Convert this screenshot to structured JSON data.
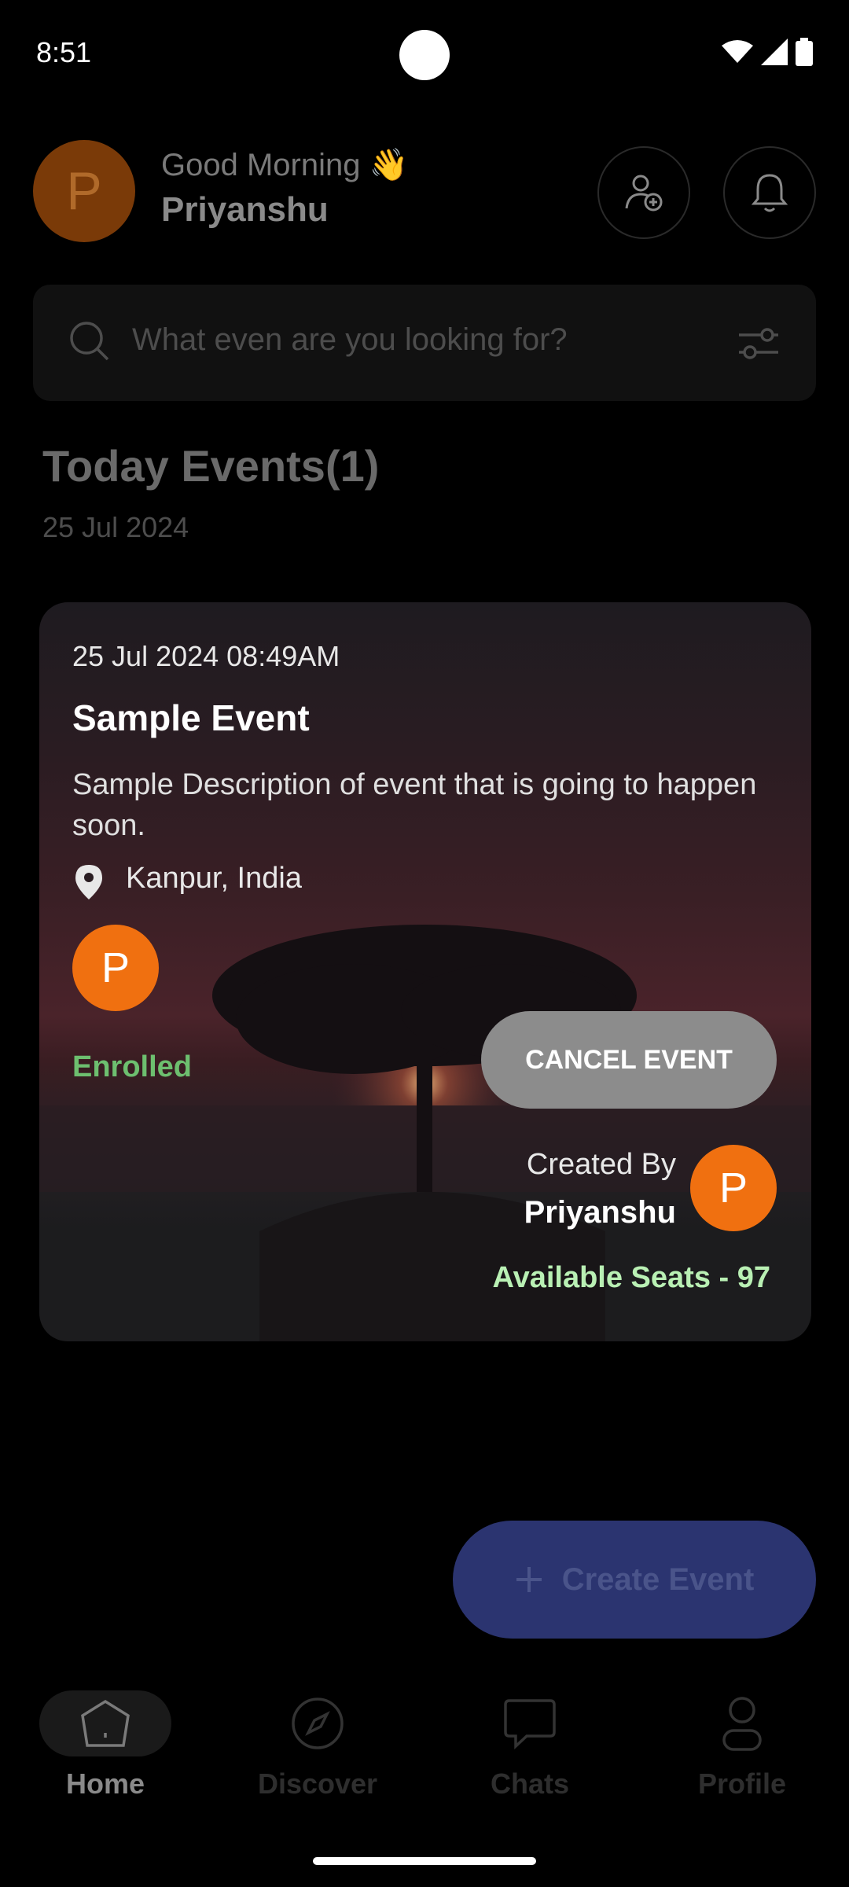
{
  "status_bar": {
    "time": "8:51"
  },
  "header": {
    "avatar_letter": "P",
    "greeting": "Good Morning 👋",
    "user_name": "Priyanshu"
  },
  "search": {
    "placeholder": "What even are you looking for?"
  },
  "section": {
    "title": "Today Events(1)",
    "date": "25 Jul 2024"
  },
  "event": {
    "datetime": "25 Jul 2024 08:49AM",
    "title": "Sample Event",
    "description": "Sample Description of event that is going to happen soon.",
    "location": "Kanpur, India",
    "participant_letter": "P",
    "status": "Enrolled",
    "cancel_label": "CANCEL EVENT",
    "created_by_label": "Created By",
    "creator_name": "Priyanshu",
    "creator_letter": "P",
    "seats": "Available Seats - 97"
  },
  "fab": {
    "label": "Create Event"
  },
  "nav": {
    "items": [
      {
        "label": "Home",
        "icon": "home-icon",
        "active": true
      },
      {
        "label": "Discover",
        "icon": "compass-icon",
        "active": false
      },
      {
        "label": "Chats",
        "icon": "chat-icon",
        "active": false
      },
      {
        "label": "Profile",
        "icon": "profile-icon",
        "active": false
      }
    ]
  },
  "colors": {
    "accent_orange": "#f07010",
    "enrolled_green": "#6dbf6f",
    "seats_green": "#b9f0b4",
    "fab_blue": "#2b3470"
  }
}
